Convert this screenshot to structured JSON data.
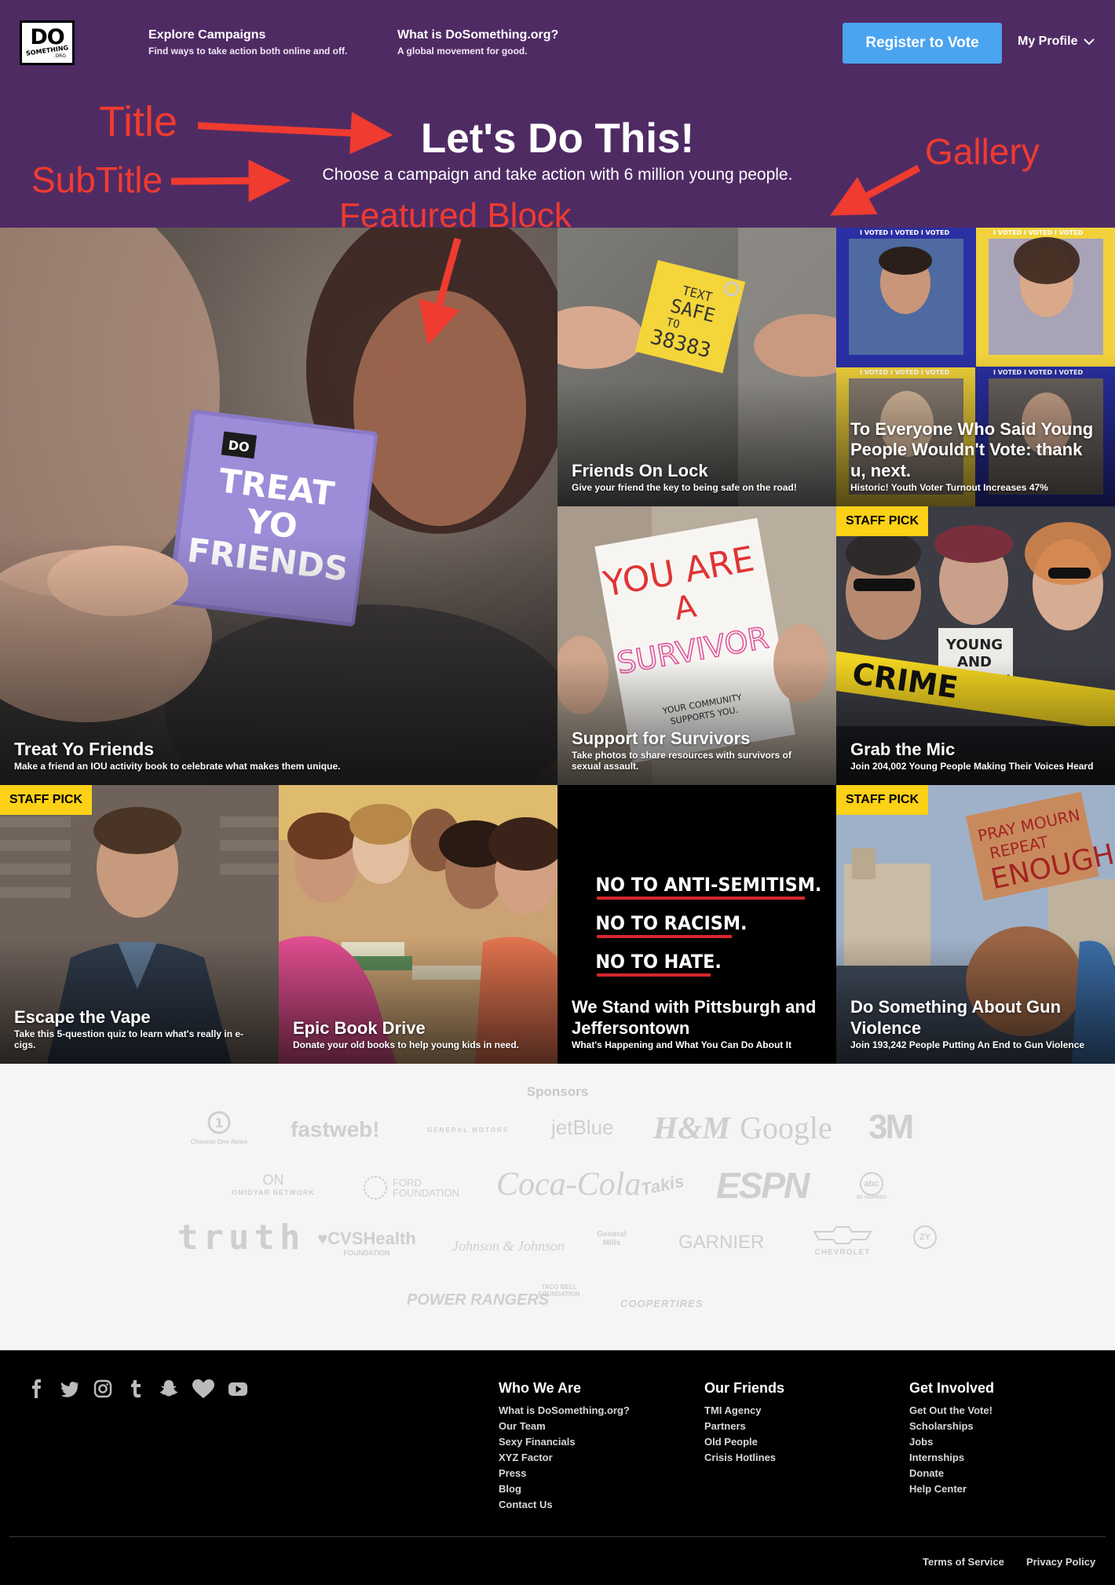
{
  "header": {
    "logo": {
      "line1": "DO",
      "line2": "SOMETHING",
      "line3": ".ORG"
    },
    "nav": [
      {
        "title": "Explore Campaigns",
        "subtitle": "Find ways to take action both online and off."
      },
      {
        "title": "What is DoSomething.org?",
        "subtitle": "A global movement for good."
      }
    ],
    "register_label": "Register to Vote",
    "profile_label": "My Profile",
    "colors": {
      "background": "#4f2b64",
      "button": "#4ba4ef"
    }
  },
  "hero": {
    "title": "Let's Do This!",
    "subtitle": "Choose a campaign and take action with 6 million young people."
  },
  "annotations": {
    "title": "Title",
    "subtitle": "SubTitle",
    "featured": "Featured Block",
    "gallery": "Gallery",
    "color": "#ef3b30"
  },
  "gallery": {
    "staff_pick_label": "STAFF PICK",
    "tiles": [
      {
        "title": "Treat Yo Friends",
        "subtitle": "Make a friend an IOU activity book to celebrate what makes them unique.",
        "staff_pick": false,
        "art_text": [
          "TREAT",
          "YO",
          "FRIENDS"
        ]
      },
      {
        "title": "Friends On Lock",
        "subtitle": "Give your friend the key to being safe on the road!",
        "staff_pick": false,
        "art_text": [
          "TEXT",
          "SAFE",
          "TO",
          "38383"
        ]
      },
      {
        "title": "To Everyone Who Said Young People Wouldn't Vote: thank u, next.",
        "subtitle": "Historic! Youth Voter Turnout Increases 47%",
        "staff_pick": false,
        "art_text": [
          "I VOTED I VOTED I VOTED"
        ]
      },
      {
        "title": "Support for Survivors",
        "subtitle": "Take photos to share resources with survivors of sexual assault.",
        "staff_pick": false,
        "art_text": [
          "YOU ARE",
          "A",
          "SURVIVOR",
          "YOUR COMMUNITY SUPPORTS YOU."
        ]
      },
      {
        "title": "Grab the Mic",
        "subtitle": "Join 204,002 Young People Making Their Voices Heard",
        "staff_pick": true,
        "art_text": [
          "CRIME",
          "YOUNG AND POWERFUL"
        ]
      },
      {
        "title": "Escape the Vape",
        "subtitle": "Take this 5-question quiz to learn what's really in e-cigs.",
        "staff_pick": true
      },
      {
        "title": "Epic Book Drive",
        "subtitle": "Donate your old books to help young kids in need.",
        "staff_pick": false
      },
      {
        "title": "We Stand with Pittsburgh and Jeffersontown",
        "subtitle": "What's Happening and What You Can Do About It",
        "staff_pick": false,
        "art_text": [
          "NO TO ANTI-SEMITISM.",
          "NO TO RACISM.",
          "NO TO HATE."
        ]
      },
      {
        "title": "Do Something About Gun Violence",
        "subtitle": "Join 193,242 People Putting An End to Gun Violence",
        "staff_pick": true,
        "art_text": [
          "PRAY",
          "MOURN",
          "REPEAT",
          "ENOUGH"
        ]
      }
    ]
  },
  "sponsors": {
    "title": "Sponsors",
    "logos": [
      "Channel One News",
      "fastweb!",
      "GENERAL MOTORS",
      "jetBlue",
      "H&M",
      "Google",
      "3M",
      "ON",
      "OMIDYAR NETWORK",
      "FORD FOUNDATION",
      "Coca-Cola",
      "Takis",
      "ESPN",
      "abc",
      "BE INSPIRED",
      "truth",
      "CVSHealth",
      "FOUNDATION",
      "Johnson & Johnson",
      "General Mills",
      "GARNIER",
      "CHEVROLET",
      "ZY",
      "POWER RANGERS",
      "TACO BELL FOUNDATION",
      "COOPERTIRES"
    ]
  },
  "footer": {
    "social_icons": [
      "facebook-icon",
      "twitter-icon",
      "instagram-icon",
      "tumblr-icon",
      "snapchat-icon",
      "heart-icon",
      "youtube-icon"
    ],
    "columns": [
      {
        "title": "Who We Are",
        "links": [
          "What is DoSomething.org?",
          "Our Team",
          "Sexy Financials",
          "XYZ Factor",
          "Press",
          "Blog",
          "Contact Us"
        ]
      },
      {
        "title": "Our Friends",
        "links": [
          "TMI Agency",
          "Partners",
          "Old People",
          "Crisis Hotlines"
        ]
      },
      {
        "title": "Get Involved",
        "links": [
          "Get Out the Vote!",
          "Scholarships",
          "Jobs",
          "Internships",
          "Donate",
          "Help Center"
        ]
      }
    ],
    "legal": [
      "Terms of Service",
      "Privacy Policy"
    ]
  }
}
